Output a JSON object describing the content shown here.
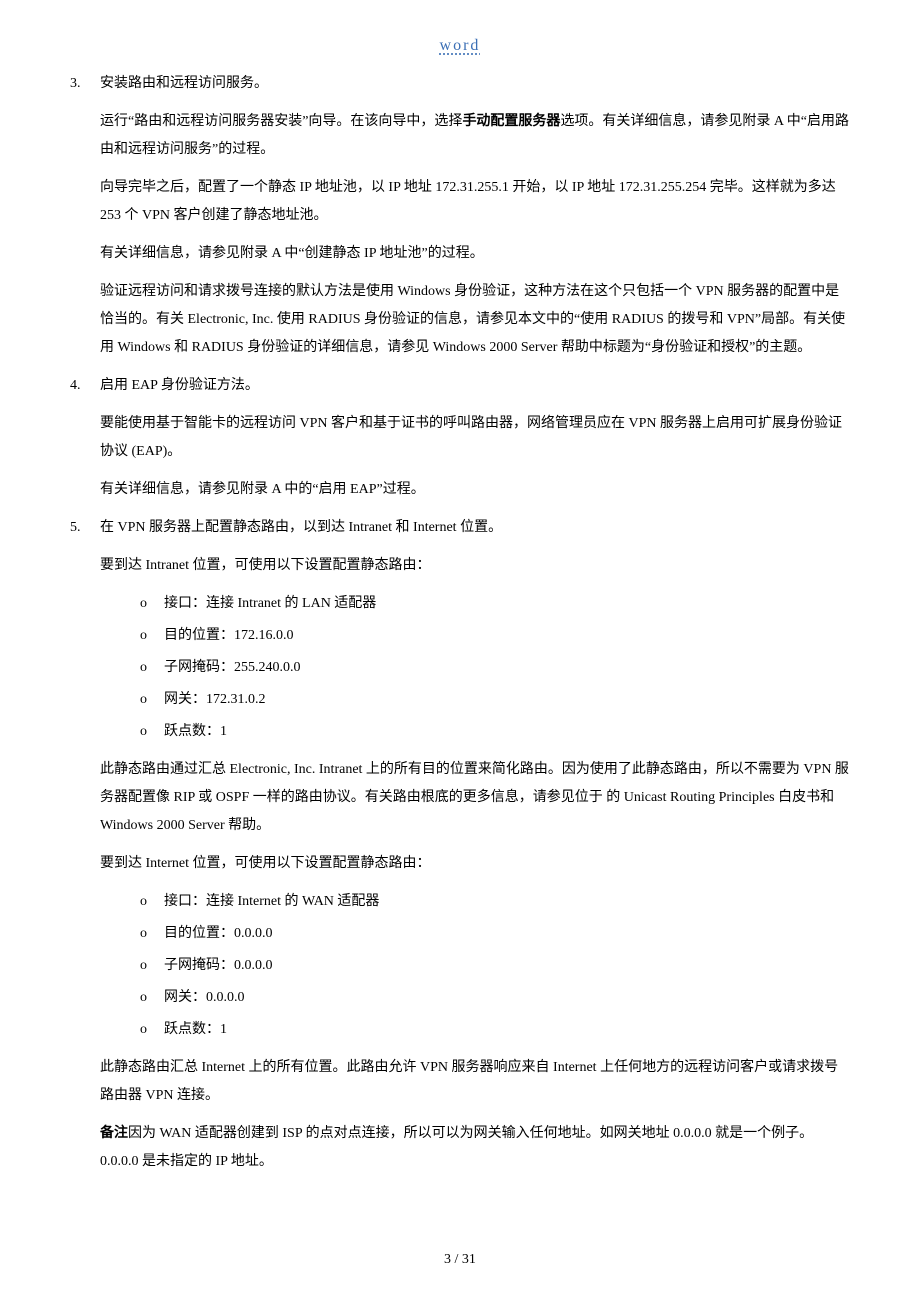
{
  "header": "word",
  "sections": {
    "s3": {
      "num": "3.",
      "title": "安装路由和远程访问服务。",
      "p1": "运行“路由和远程访问服务器安装”向导。在该向导中，选择",
      "p1_bold": "手动配置服务器",
      "p1_after": "选项。有关详细信息，请参见附录 A 中“启用路由和远程访问服务”的过程。",
      "p2": "向导完毕之后，配置了一个静态 IP 地址池，以 IP 地址 172.31.255.1 开始，以 IP 地址 172.31.255.254 完毕。这样就为多达 253 个 VPN 客户创建了静态地址池。",
      "p3": "有关详细信息，请参见附录 A 中“创建静态 IP 地址池”的过程。",
      "p4": "验证远程访问和请求拨号连接的默认方法是使用 Windows 身份验证，这种方法在这个只包括一个 VPN 服务器的配置中是恰当的。有关 Electronic, Inc. 使用 RADIUS 身份验证的信息，请参见本文中的“使用 RADIUS 的拨号和 VPN”局部。有关使用 Windows 和 RADIUS 身份验证的详细信息，请参见 Windows 2000 Server 帮助中标题为“身份验证和授权”的主题。"
    },
    "s4": {
      "num": "4.",
      "title": "启用 EAP 身份验证方法。",
      "p1": "要能使用基于智能卡的远程访问 VPN 客户和基于证书的呼叫路由器，网络管理员应在 VPN 服务器上启用可扩展身份验证协议 (EAP)。",
      "p2": "有关详细信息，请参见附录 A 中的“启用 EAP”过程。"
    },
    "s5": {
      "num": "5.",
      "title": "在 VPN 服务器上配置静态路由，以到达 Intranet 和 Internet 位置。",
      "p1": "要到达 Intranet 位置，可使用以下设置配置静态路由：",
      "list1": [
        "接口：连接 Intranet 的 LAN 适配器",
        "目的位置：172.16.0.0",
        "子网掩码：255.240.0.0",
        "网关：172.31.0.2",
        "跃点数：1"
      ],
      "p2": "此静态路由通过汇总 Electronic, Inc. Intranet 上的所有目的位置来简化路由。因为使用了此静态路由，所以不需要为 VPN 服务器配置像 RIP 或 OSPF 一样的路由协议。有关路由根底的更多信息，请参见位于 的 Unicast Routing Principles 白皮书和 Windows 2000 Server 帮助。",
      "p3": "要到达 Internet 位置，可使用以下设置配置静态路由：",
      "list2": [
        "接口：连接 Internet 的 WAN 适配器",
        "目的位置：0.0.0.0",
        "子网掩码：0.0.0.0",
        "网关：0.0.0.0",
        "跃点数：1"
      ],
      "p4": "此静态路由汇总 Internet 上的所有位置。此路由允许 VPN 服务器响应来自 Internet 上任何地方的远程访问客户或请求拨号路由器 VPN 连接。",
      "note_label": "备注",
      "note_body": "因为 WAN 适配器创建到 ISP 的点对点连接，所以可以为网关输入任何地址。如网关地址 0.0.0.0 就是一个例子。0.0.0.0 是未指定的 IP 地址。"
    }
  },
  "footer": "3 / 31"
}
